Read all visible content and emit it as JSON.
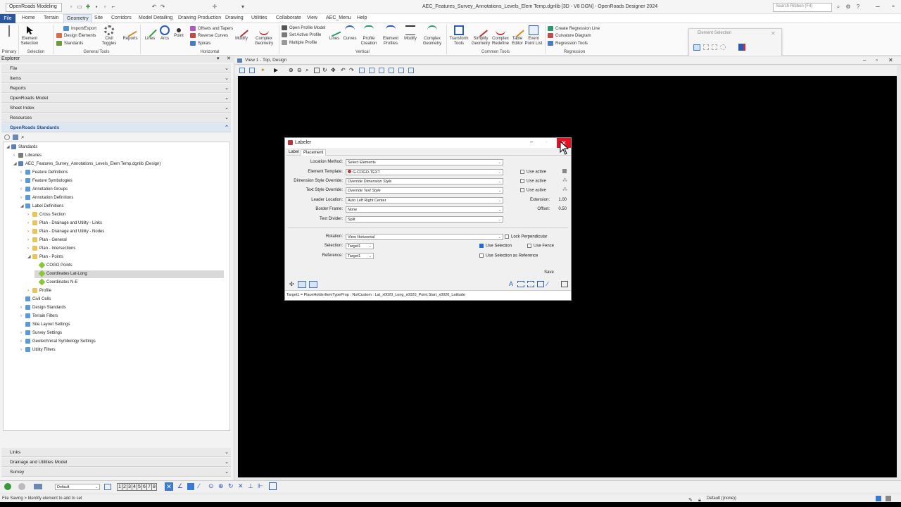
{
  "qat": {
    "workspace": "OpenRoads Modeling",
    "window_title": "AEC_Features_Survey_Annotations_Levels_Elem Temp.dgnlib [3D - V8 DGN] - OpenRoads Designer 2024",
    "search_placeholder": "Search Ribbon (F4)"
  },
  "menu": [
    "File",
    "Home",
    "Terrain",
    "Geometry",
    "Site",
    "Corridors",
    "Model Detailing",
    "Drawing Production",
    "Drawing",
    "Utilities",
    "Collaborate",
    "View",
    "AEC_Menu",
    "Help"
  ],
  "ribbon": {
    "element_selection": "Element Selection",
    "import_export": "Import/Export",
    "design_elements": "Design Elements",
    "standards": "Standards",
    "civil_toggles": "Civil Toggles",
    "reports": "Reports",
    "lines": "Lines",
    "arcs": "Arcs",
    "point": "Point",
    "offsets_tapers": "Offsets and Tapers",
    "reverse_curves": "Reverse Curves",
    "spirals": "Spirals",
    "modify": "Modify",
    "complex_geometry": "Complex Geometry",
    "open_profile_model": "Open Profile Model",
    "set_active_profile": "Set Active Profile",
    "multiple_profile": "Multiple Profile",
    "v_lines": "Lines",
    "v_curves": "Curves",
    "profile_creation": "Profile Creation",
    "element_profiles": "Element Profiles",
    "v_modify": "Modify",
    "v_complex_geometry": "Complex Geometry",
    "transform_tools": "Transform Tools",
    "simplify_geometry": "Simplify Geometry",
    "complex_redefine": "Complex Redefine",
    "table_editor": "Table Editor",
    "event_point_list": "Event Point List",
    "create_regression_line": "Create Regression Line",
    "curvature_diagram": "Curvature Diagram",
    "regression_tools": "Regression Tools",
    "groups": {
      "primary": "Primary",
      "selection": "Selection",
      "general_tools": "General Tools",
      "horizontal": "Horizontal",
      "vertical": "Vertical",
      "common_tools": "Common Tools",
      "regression": "Regression"
    }
  },
  "element_selection_panel": {
    "title": "Element Selection"
  },
  "explorer": {
    "title": "Explorer",
    "sections_top": [
      "File",
      "Items",
      "Reports",
      "OpenRoads Model",
      "Sheet Index",
      "Resources",
      "OpenRoads Standards"
    ],
    "sections_bottom": [
      "Links",
      "Drainage and Utilities Model",
      "Survey"
    ],
    "tree": [
      "Standards",
      "Libraries",
      "AEC_Features_Survey_Annotations_Levels_Elem Temp.dgnlib (Design)",
      "Feature Definitions",
      "Feature Symbologies",
      "Annotation Groups",
      "Annotation Definitions",
      "Label Definitions",
      "Cross Section",
      "Plan - Drainage and Utility - Links",
      "Plan - Drainage and Utility - Nodes",
      "Plan - General",
      "Plan - Intersections",
      "Plan - Points",
      "COGO Points",
      "Coordinates Lat-Long",
      "Coordinates N-E",
      "Profile",
      "Civil Cells",
      "Design Standards",
      "Terrain Filters",
      "Site Layout Settings",
      "Survey Settings",
      "Geotechnical Symbology Settings",
      "Utility Filters"
    ]
  },
  "view": {
    "title": "View 1 - Top, Design"
  },
  "labeler": {
    "title": "Labeler",
    "tabs": [
      "Label",
      "Placement"
    ],
    "location_method_label": "Location Method:",
    "location_method": "Select Elements",
    "element_template_label": "Element Template:",
    "element_template": "G-COGO-TEXT",
    "dim_style_label": "Dimension Style Override:",
    "dim_style": "Override Dimension Style",
    "text_style_label": "Text Style Override:",
    "text_style": "Override Text Style",
    "leader_location_label": "Leader Location:",
    "leader_location": "Auto Left Right Center",
    "border_frame_label": "Border Frame:",
    "border_frame": "None",
    "text_divider_label": "Text Divider:",
    "text_divider": "Split",
    "use_active": "Use active",
    "extension_label": "Extension:",
    "extension": "1.00",
    "offset_label": "Offset:",
    "offset": "0.50",
    "rotation_label": "Rotation:",
    "rotation": "View Horizontal",
    "lock_perpendicular": "Lock Perpendicular",
    "selection_label": "Selection:",
    "selection": "Target1",
    "reference_label": "Reference:",
    "reference": "Target1",
    "use_selection": "Use Selection",
    "use_fence": "Use Fence",
    "use_selection_as_reference": "Use Selection as Reference",
    "save": "Save",
    "footer": "Target1 = PlaceHolderItemTypeProp : NotCustom : Lat_x0020_Long_x0020_Point.Start_x0020_Latitude"
  },
  "status": {
    "level": "Default",
    "views": [
      "1",
      "2",
      "3",
      "4",
      "5",
      "6",
      "7",
      "8"
    ],
    "message": "File Saving > Identify element to add to set",
    "right": "Default ((none))"
  },
  "colors": {
    "accent": "#2b579a",
    "close": "#e81123",
    "folder": "#e8c45a",
    "item": "#8cc63f"
  }
}
